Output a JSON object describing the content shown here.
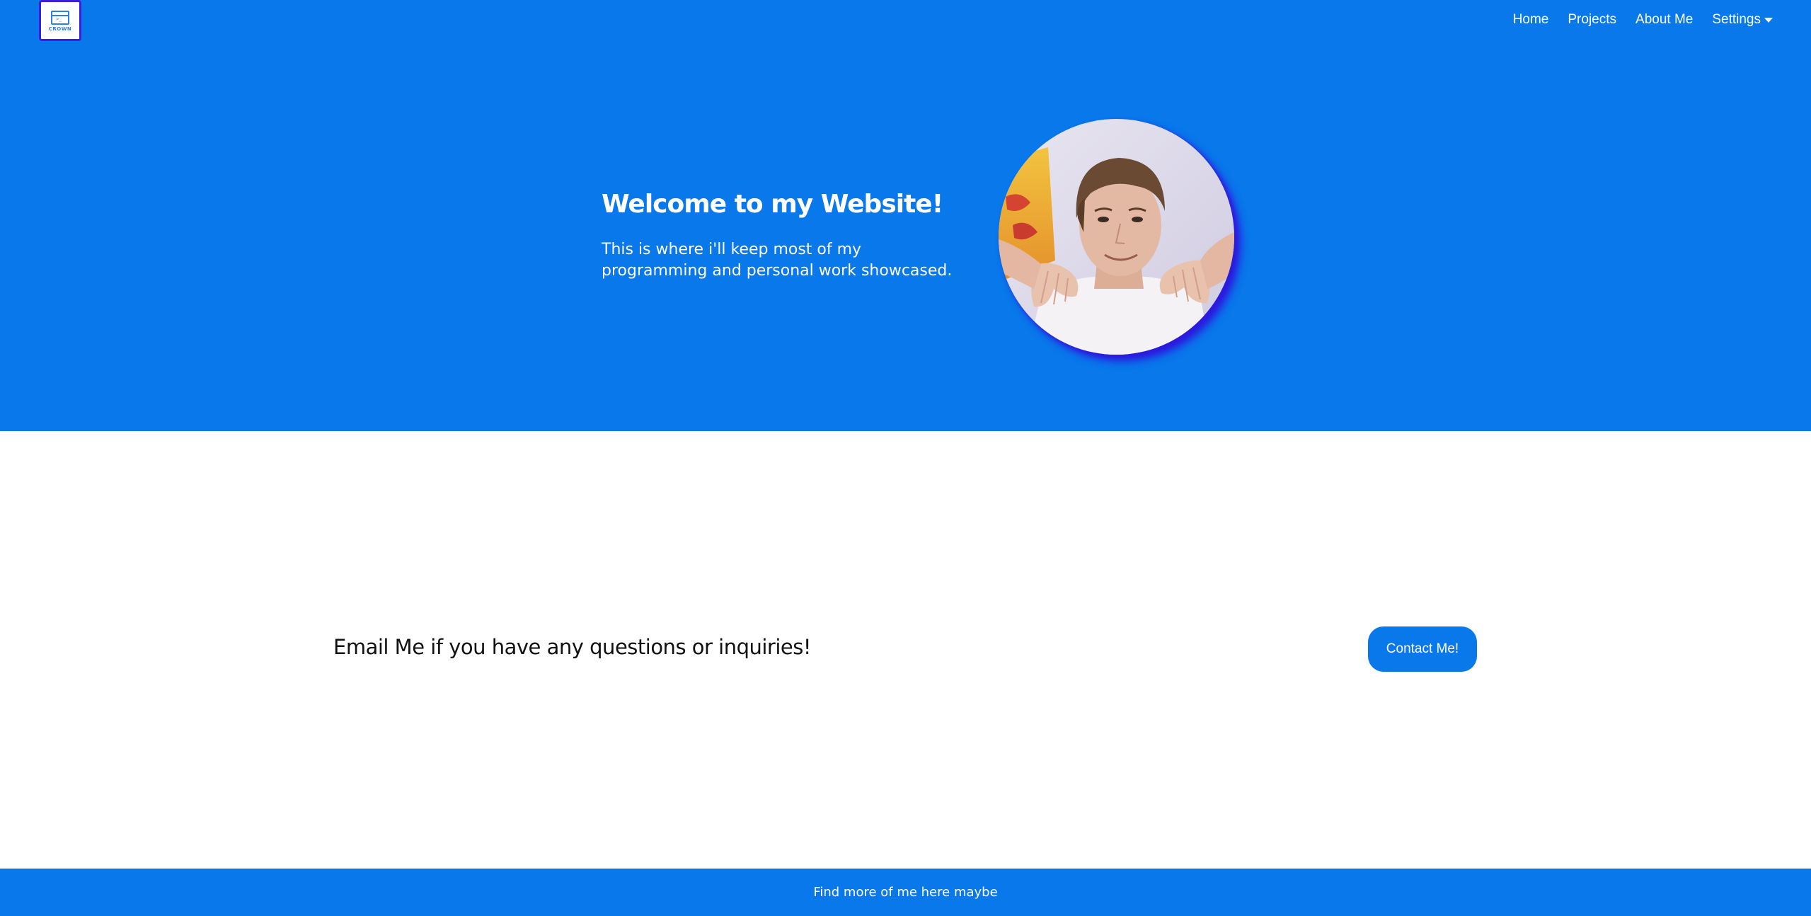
{
  "brand": {
    "logo_icon": "terminal-window-icon",
    "logo_caption": "CROWN",
    "logo_prompt": ">_"
  },
  "nav": {
    "items": [
      {
        "label": "Home"
      },
      {
        "label": "Projects"
      },
      {
        "label": "About Me"
      }
    ],
    "settings": {
      "label": "Settings",
      "icon": "caret-down-icon"
    }
  },
  "hero": {
    "title": "Welcome to my Website!",
    "text": "This is where i'll keep most of my programming and personal work showcased.",
    "avatar": "profile-photo"
  },
  "contact": {
    "text": "Email Me if you have any questions or inquiries!",
    "button_label": "Contact Me!"
  },
  "footer": {
    "text": "Find more of me here maybe"
  },
  "colors": {
    "primary": "#0878eb",
    "avatar_glow": "#2b1bde",
    "logo_border": "#3a1fe0",
    "text_dark": "#111111"
  }
}
